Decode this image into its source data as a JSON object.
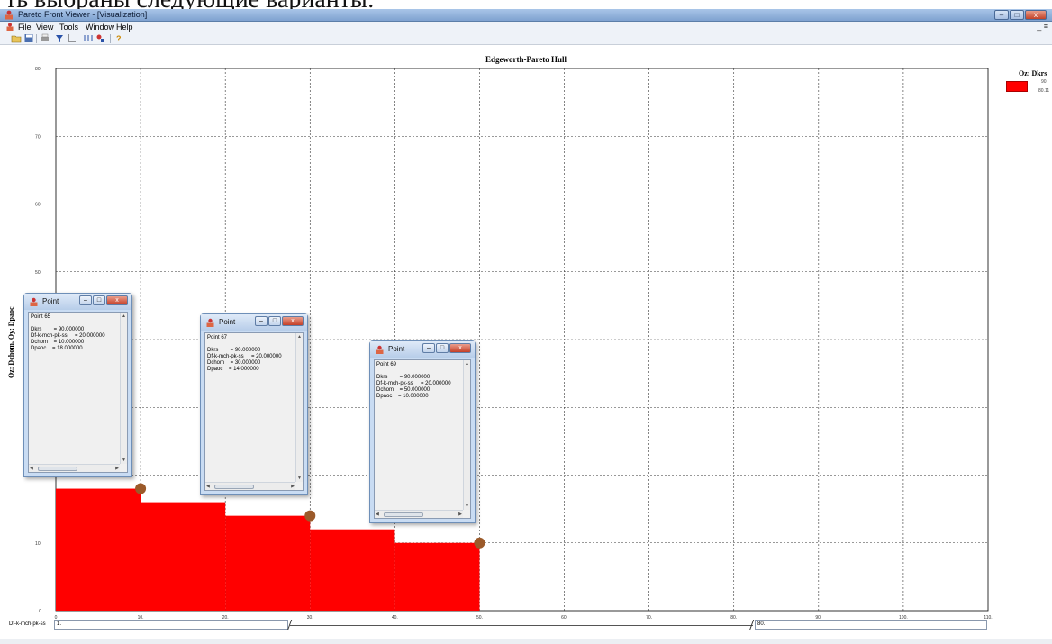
{
  "top_fragment": "ть выбраны следующие варианты:",
  "window": {
    "title": "Pareto Front Viewer - [Visualization]",
    "controls": [
      "–",
      "□",
      "x"
    ]
  },
  "menu": {
    "items": [
      "File",
      "View",
      "Tools",
      "Window",
      "Help"
    ],
    "mdi_controls": "_ ≡"
  },
  "toolbar": {
    "icons": [
      "open-icon",
      "save-icon",
      "print-icon",
      "filter-icon",
      "axis-icon",
      "points-icon",
      "tools-icon",
      "help-icon"
    ]
  },
  "chart_data": {
    "type": "area",
    "title": "Edgeworth-Pareto Hull",
    "ylabel": "Oz: Dchom, Oy: Dpaoc",
    "xlim": [
      0,
      110
    ],
    "ylim": [
      0,
      80
    ],
    "x_ticks": [
      "0",
      "10.",
      "20.",
      "30.",
      "40.",
      "50.",
      "60.",
      "70.",
      "80.",
      "90.",
      "100.",
      "110."
    ],
    "y_ticks": [
      "0",
      "10.",
      "20.",
      "30.",
      "40.",
      "50.",
      "60.",
      "70.",
      "80."
    ],
    "grid": true,
    "hull_steps": [
      {
        "x0": 0,
        "x1": 10,
        "y": 18
      },
      {
        "x0": 10,
        "x1": 20,
        "y": 16
      },
      {
        "x0": 20,
        "x1": 30,
        "y": 14
      },
      {
        "x0": 30,
        "x1": 40,
        "y": 12
      },
      {
        "x0": 40,
        "x1": 50,
        "y": 10
      }
    ],
    "points": [
      {
        "x": 10,
        "y": 18
      },
      {
        "x": 30,
        "y": 14
      },
      {
        "x": 50,
        "y": 10
      }
    ],
    "fill_color": "#ff0000",
    "point_color": "#9b5a2a"
  },
  "legend": {
    "title": "Oz: Dkrs",
    "top_value": "90.",
    "bottom_value": "80.11"
  },
  "slider": {
    "label": "Df-k-mch-pk-ss",
    "min_value": "1.",
    "max_value": "80."
  },
  "point_windows": [
    {
      "title": "Point",
      "text": "Point 65\n\nDkrs        = 90.000000\nDf-k-mch-pk-ss     = 20.000000\nDchom    = 10.000000\nDpaoc    = 18.000000"
    },
    {
      "title": "Point",
      "text": "Point 67\n\nDkrs        = 90.000000\nDf-k-mch-pk-ss     = 20.000000\nDchom    = 30.000000\nDpaoc    = 14.000000"
    },
    {
      "title": "Point",
      "text": "Point 69\n\nDkrs        = 90.000000\nDf-k-mch-pk-ss     = 20.000000\nDchom    = 50.000000\nDpaoc    = 10.000000"
    }
  ]
}
